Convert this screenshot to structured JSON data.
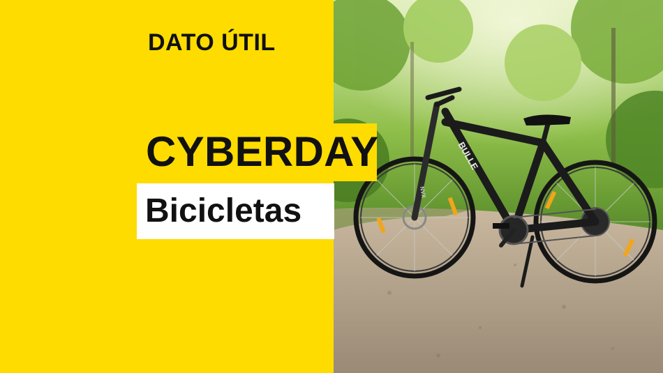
{
  "banner": {
    "kicker": "DATO ÚTIL",
    "headline": "CYBERDAY",
    "subheadline": "Bicicletas",
    "colors": {
      "accent": "#fedc00",
      "text": "#111111",
      "label_bg": "#ffffff"
    }
  },
  "photo": {
    "frame_text": "BULLE",
    "fork_text": "NVX"
  }
}
